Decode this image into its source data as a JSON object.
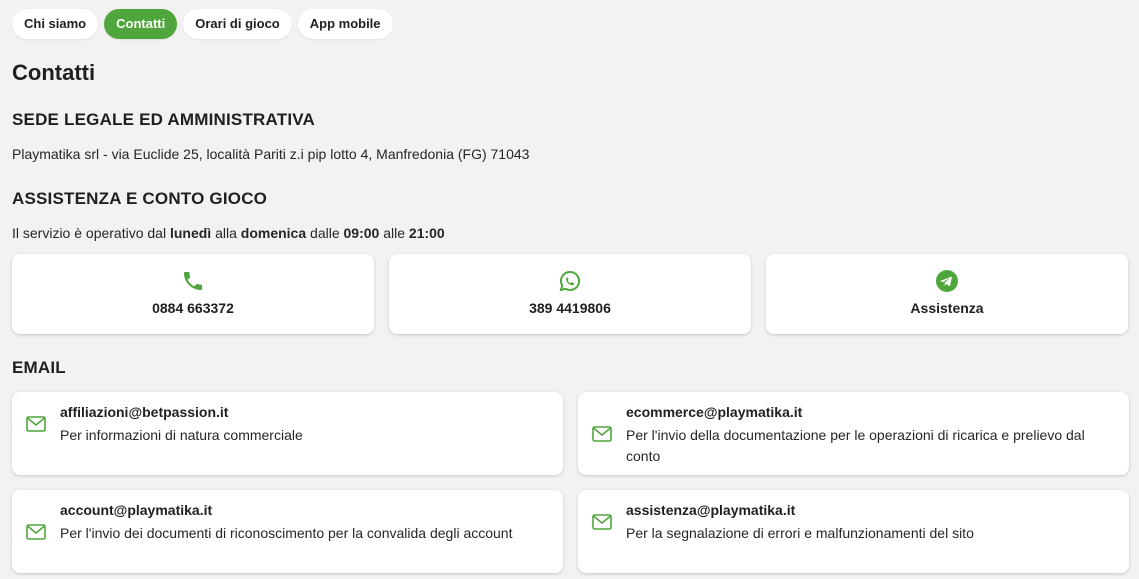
{
  "tabs": [
    {
      "label": "Chi siamo",
      "active": false
    },
    {
      "label": "Contatti",
      "active": true
    },
    {
      "label": "Orari di gioco",
      "active": false
    },
    {
      "label": "App mobile",
      "active": false
    }
  ],
  "page_title": "Contatti",
  "legal": {
    "heading": "SEDE LEGALE ED AMMINISTRATIVA",
    "address": "Playmatika srl - via Euclide 25, località Pariti z.i pip lotto 4, Manfredonia (FG) 71043"
  },
  "support": {
    "heading": "ASSISTENZA E CONTO GIOCO",
    "hours": {
      "prefix": "Il servizio è operativo dal",
      "day_from": "lunedì",
      "mid1": "alla",
      "day_to": "domenica",
      "mid2": "dalle",
      "time_from": "09:00",
      "mid3": "alle",
      "time_to": "21:00"
    },
    "channels": [
      {
        "icon": "phone-icon",
        "label": "0884 663372"
      },
      {
        "icon": "whatsapp-icon",
        "label": "389 4419806"
      },
      {
        "icon": "telegram-icon",
        "label": "Assistenza"
      }
    ]
  },
  "email": {
    "heading": "EMAIL",
    "items": [
      {
        "address": "affiliazioni@betpassion.it",
        "description": "Per informazioni di natura commerciale"
      },
      {
        "address": "ecommerce@playmatika.it",
        "description": "Per l'invio della documentazione per le operazioni di ricarica e prelievo dal conto"
      },
      {
        "address": "account@playmatika.it",
        "description": "Per l'invio dei documenti di riconoscimento per la convalida degli account"
      },
      {
        "address": "assistenza@playmatika.it",
        "description": "Per la segnalazione di errori e malfunzionamenti del sito"
      }
    ]
  },
  "colors": {
    "accent": "#4fa63c",
    "background": "#f2f2f2",
    "card": "#ffffff",
    "text": "#1f1f1f"
  }
}
